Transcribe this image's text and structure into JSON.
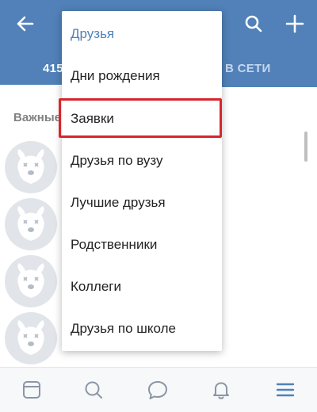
{
  "header": {
    "tabs": [
      {
        "label": "415",
        "active": true
      },
      {
        "label": "В СЕТИ",
        "active": false
      }
    ],
    "icons": [
      "back-arrow-icon",
      "search-icon",
      "plus-icon"
    ]
  },
  "content": {
    "section_title": "Важные"
  },
  "dropdown": {
    "items": [
      {
        "label": "Друзья",
        "selected": true
      },
      {
        "label": "Дни рождения"
      },
      {
        "label": "Заявки",
        "highlighted": true
      },
      {
        "label": "Друзья по вузу"
      },
      {
        "label": "Лучшие друзья"
      },
      {
        "label": "Родственники"
      },
      {
        "label": "Коллеги"
      },
      {
        "label": "Друзья по школе"
      }
    ]
  },
  "bottom_nav": {
    "icons": [
      "news-icon",
      "search-icon",
      "messages-icon",
      "notifications-icon",
      "menu-icon"
    ],
    "active": "menu-icon"
  },
  "colors": {
    "header_bg": "#5181b8",
    "accent": "#5181b8",
    "highlight": "#d6262c",
    "avatar_bg": "#e1e5ea"
  }
}
